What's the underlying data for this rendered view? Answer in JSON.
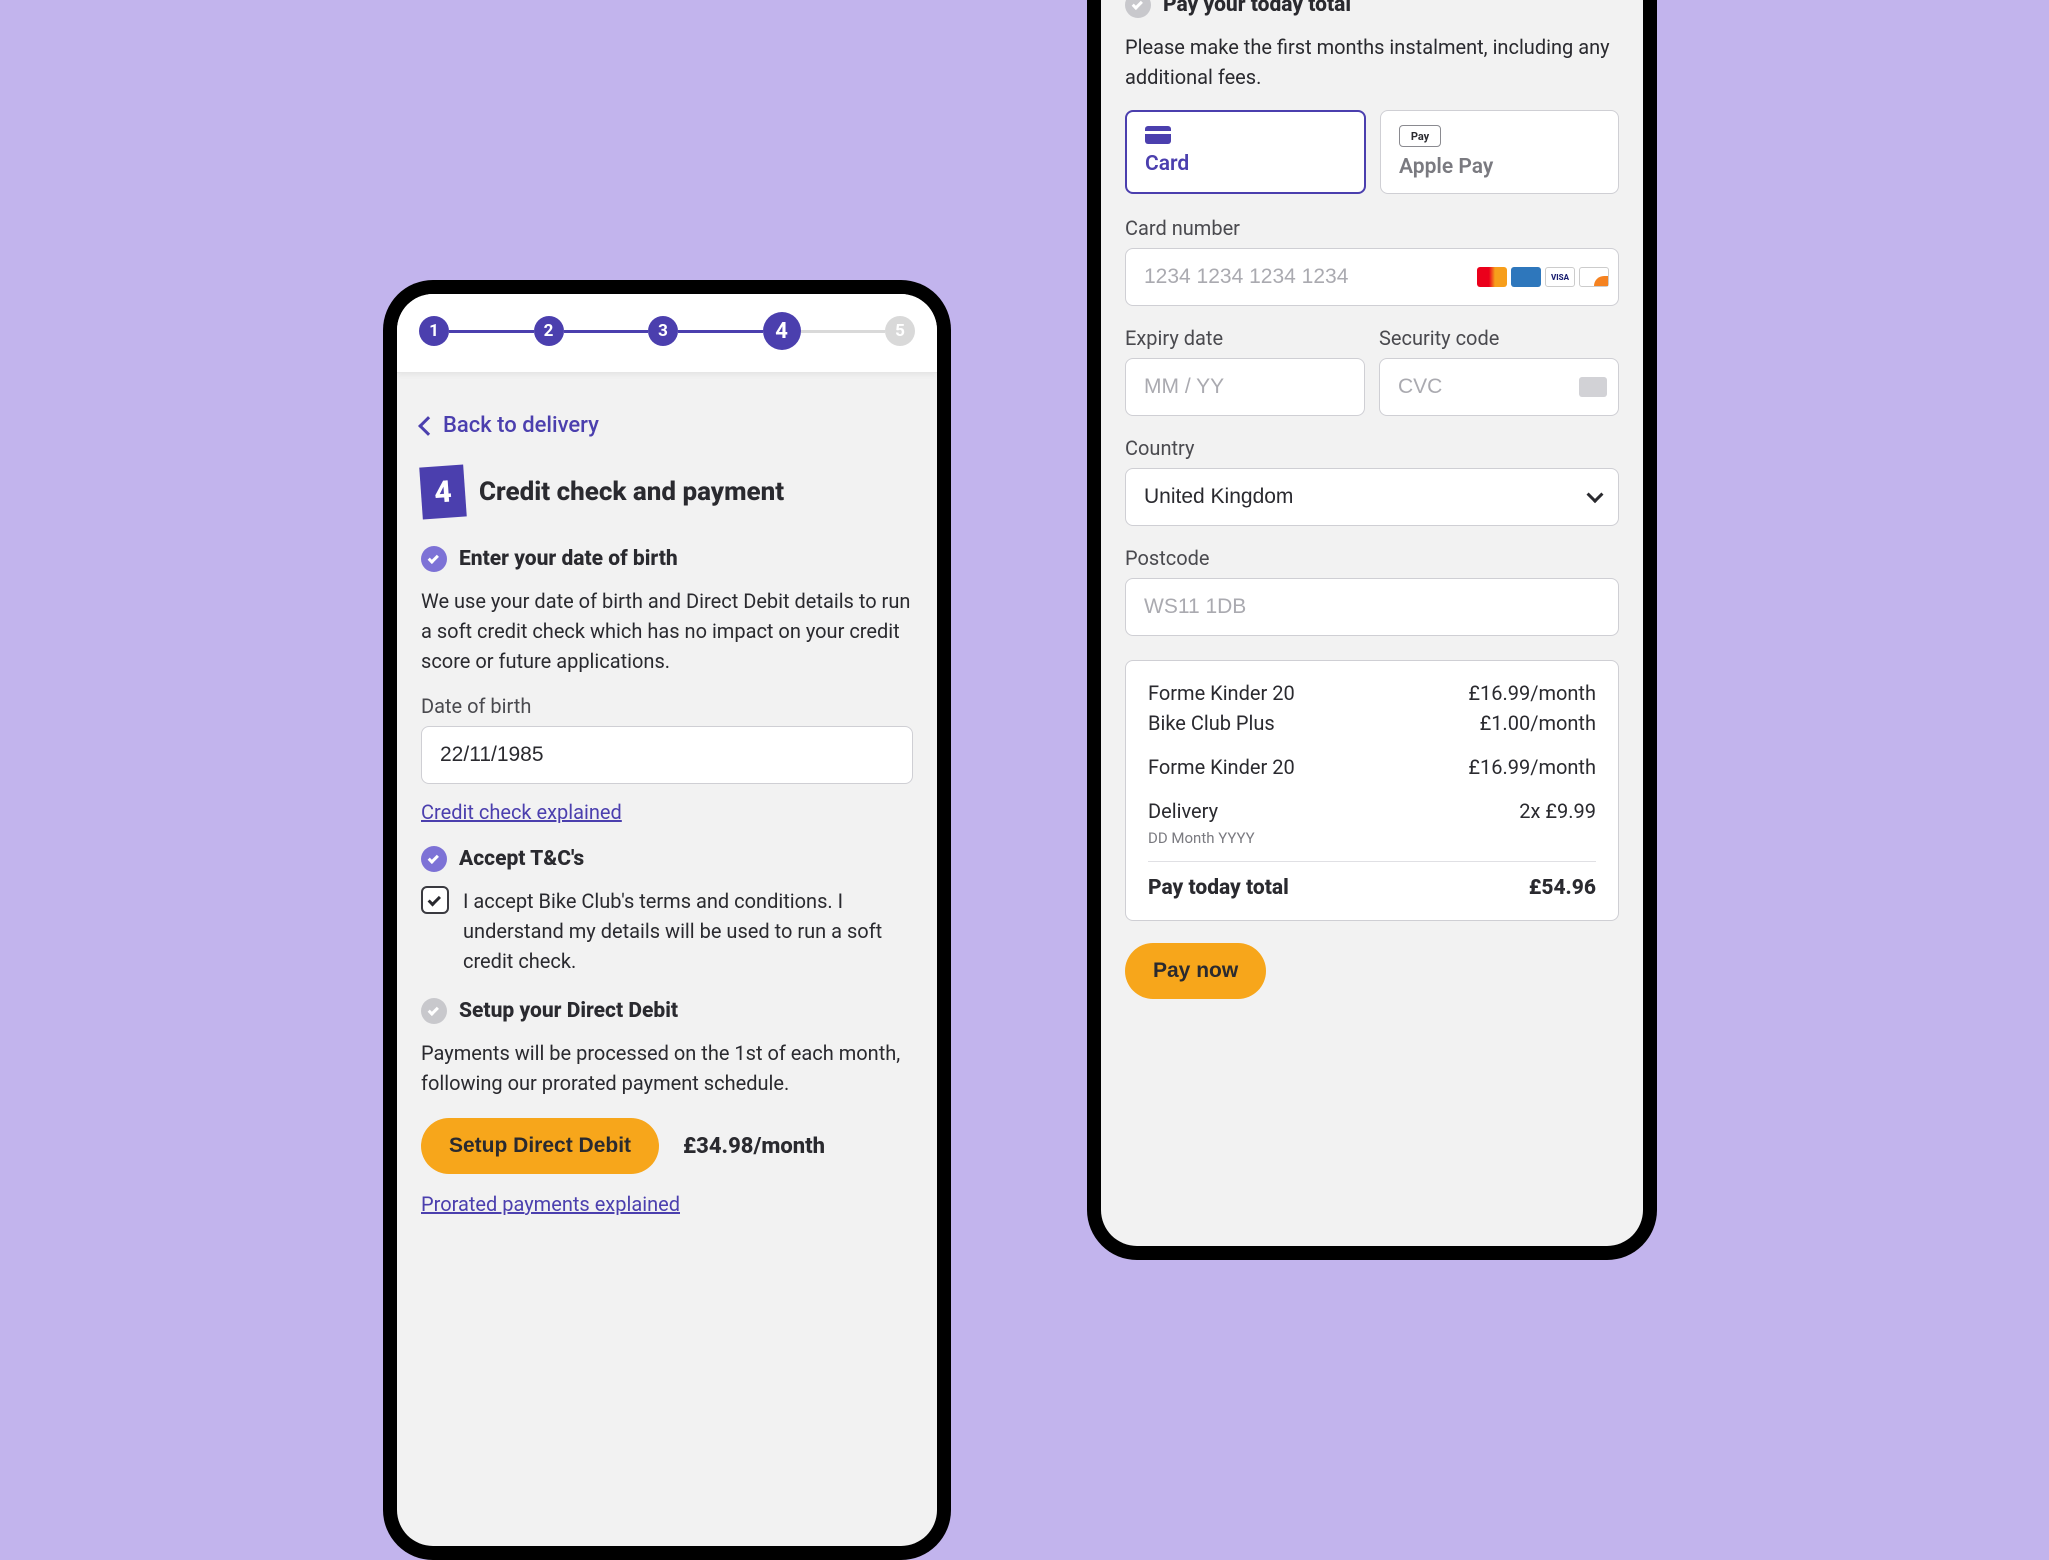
{
  "stepper": {
    "steps": [
      "1",
      "2",
      "3",
      "4",
      "5"
    ],
    "current_index": 3
  },
  "left": {
    "back_label": "Back to delivery",
    "step_badge": "4",
    "page_title": "Credit check and payment",
    "dob_section": {
      "title": "Enter your date of birth",
      "body": "We use your date of birth and Direct Debit details to run a soft credit check which has no impact on your credit score or future applications.",
      "field_label": "Date of birth",
      "value": "22/11/1985",
      "link": "Credit check explained"
    },
    "tc_section": {
      "title": "Accept T&C's",
      "checkbox_text": "I accept Bike Club's terms and conditions. I understand my details will be used to run a soft credit check."
    },
    "dd_section": {
      "title": "Setup your Direct Debit",
      "body": "Payments will be processed on the 1st of each month, following our prorated payment schedule.",
      "button": "Setup Direct Debit",
      "amount": "£34.98/month",
      "link": "Prorated payments explained"
    }
  },
  "right": {
    "pay_section_title": "Pay your today total",
    "pay_intro": "Please make the first months instalment, including any additional fees.",
    "method_card": "Card",
    "method_apple": "Apple Pay",
    "card_number_label": "Card number",
    "card_number_placeholder": "1234 1234 1234 1234",
    "expiry_label": "Expiry date",
    "expiry_placeholder": "MM / YY",
    "cvc_label": "Security code",
    "cvc_placeholder": "CVC",
    "country_label": "Country",
    "country_value": "United Kingdom",
    "postcode_label": "Postcode",
    "postcode_placeholder": "WS11 1DB",
    "summary": {
      "lines": [
        {
          "label": "Forme Kinder 20",
          "price": "£16.99/month"
        },
        {
          "label": "Bike Club Plus",
          "price": "£1.00/month"
        },
        {
          "label": "Forme Kinder 20",
          "price": "£16.99/month"
        }
      ],
      "delivery_label": "Delivery",
      "delivery_price": "2x £9.99",
      "delivery_date": "DD Month YYYY",
      "total_label": "Pay today total",
      "total_price": "£54.96"
    },
    "pay_button": "Pay now"
  }
}
